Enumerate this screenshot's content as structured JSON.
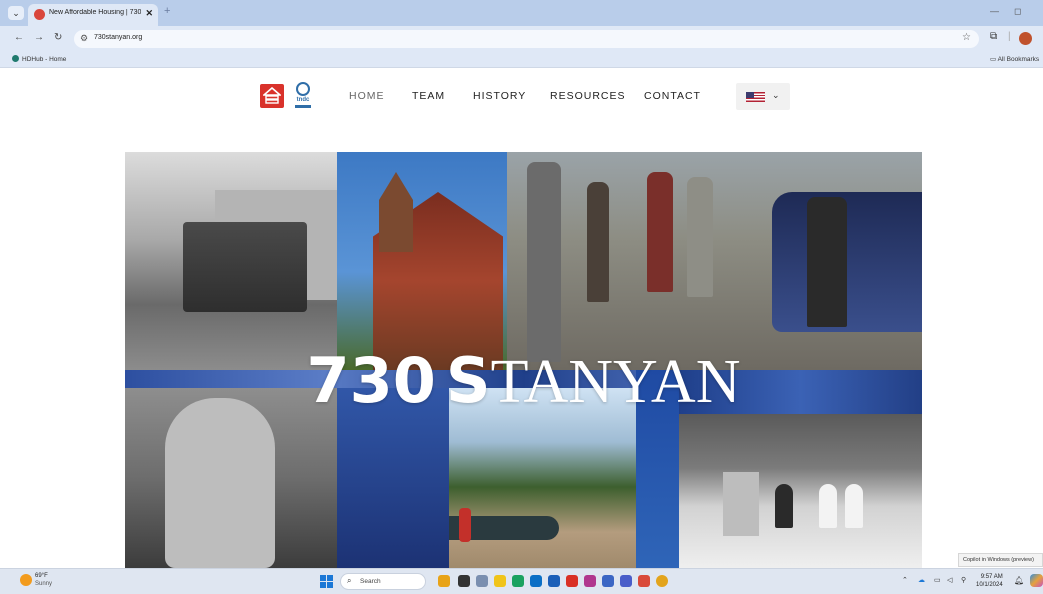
{
  "browser": {
    "tab_title": "New Affordable Housing | 730",
    "tab_close": "✕",
    "new_tab": "+",
    "url": "730stanyan.org",
    "bookmark_home": "HDHub - Home",
    "bookmark_all": "All Bookmarks",
    "icons": [
      "tab-menu-icon",
      "back-icon",
      "forward-icon",
      "reload-icon",
      "site-info-icon",
      "star-icon",
      "extensions-icon",
      "profile-icon",
      "folder-icon"
    ]
  },
  "site": {
    "logo_tndc_text": "tndc",
    "nav": [
      {
        "label": "HOME",
        "active": true
      },
      {
        "label": "TEAM"
      },
      {
        "label": "HISTORY"
      },
      {
        "label": "RESOURCES"
      },
      {
        "label": "CONTACT"
      }
    ],
    "language_flag": "us-flag",
    "hero": {
      "num": "730",
      "word_bold": "S",
      "word_rest": "TANYAN"
    }
  },
  "copilot_toast": "Copilot in Windows (preview)",
  "taskbar": {
    "weather_temp": "69°F",
    "weather_cond": "Sunny",
    "search_placeholder": "Search",
    "time": "9:57 AM",
    "date": "10/1/2024",
    "colors": {
      "accent": "#1c78d6",
      "brand_red": "#d9322b",
      "tndc_blue": "#2f6ea8"
    }
  }
}
